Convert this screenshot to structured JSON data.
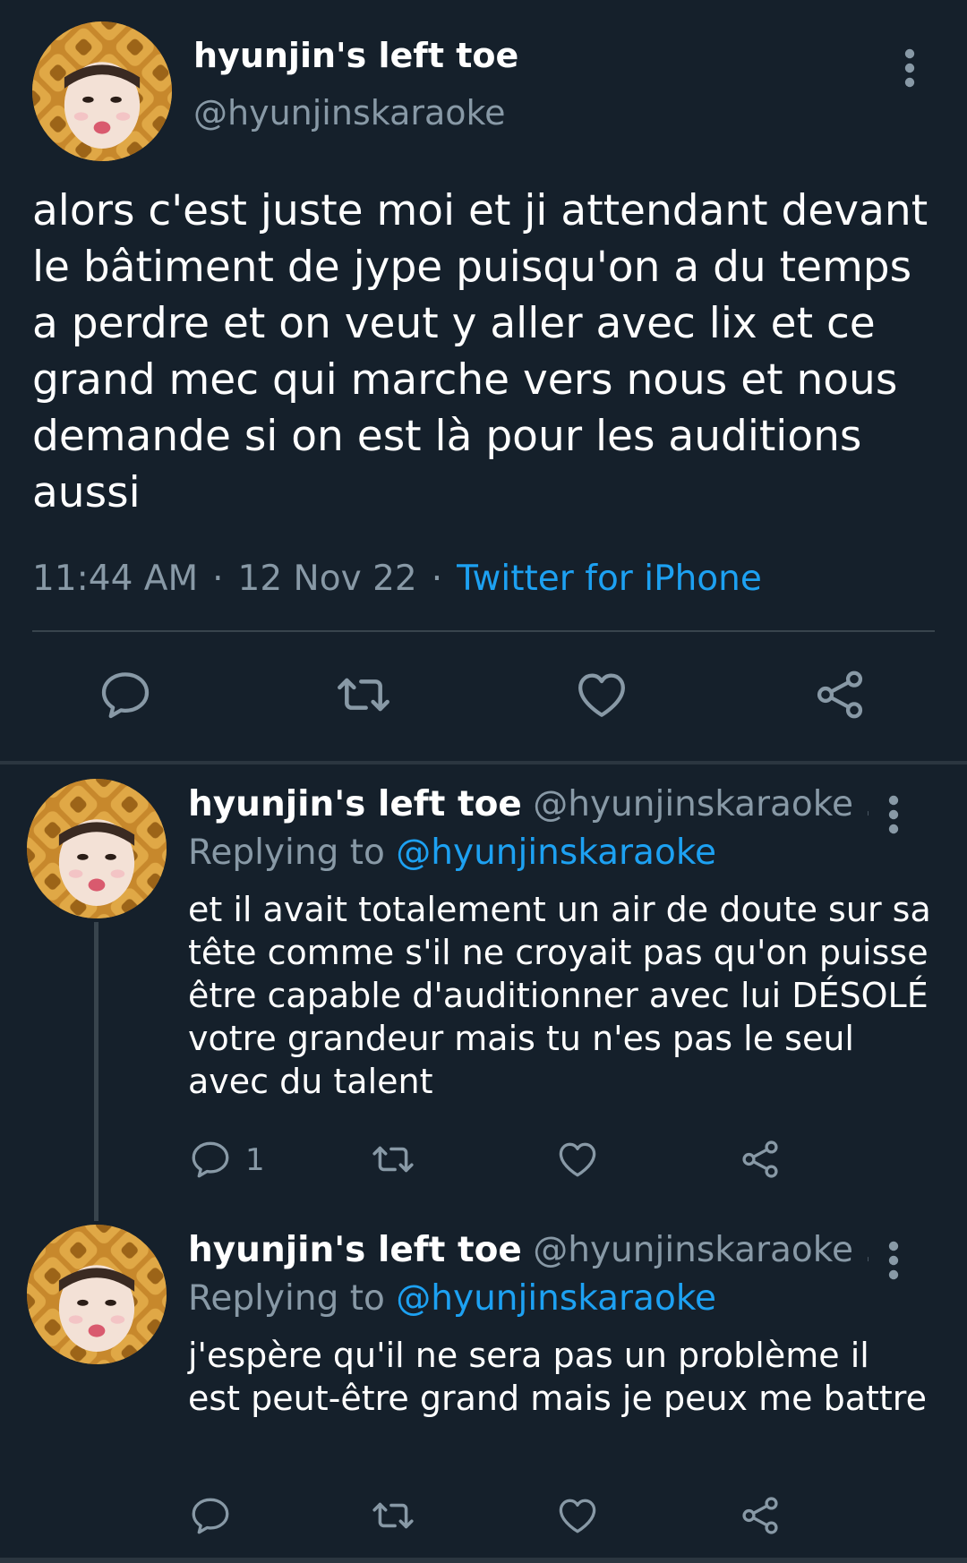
{
  "theme": {
    "background": "#15202b",
    "text": "#ffffff",
    "muted": "#8899a6",
    "accent": "#1da1f2",
    "divider": "#38444d"
  },
  "main_tweet": {
    "display_name": "hyunjin's left toe",
    "handle": "@hyunjinskaraoke",
    "avatar_icon": "avatar-pineapple-hood",
    "more_icon": "more-vertical-icon",
    "text": "alors c'est juste moi et ji attendant devant le bâtiment de jype puisqu'on a du temps a perdre et on veut y aller avec lix et ce grand mec qui marche vers nous et nous demande si on est là pour les auditions aussi",
    "time": "11:44 AM",
    "date": "12 Nov 22",
    "separator": "·",
    "source": "Twitter for iPhone",
    "actions": [
      "reply-icon",
      "retweet-icon",
      "like-icon",
      "share-icon"
    ]
  },
  "replies": [
    {
      "display_name": "hyunjin's left toe",
      "handle": "@hyunjinskaraoke ...",
      "replying_prefix": "Replying to ",
      "replying_to": "@hyunjinskaraoke",
      "text": "et il avait totalement un air de doute sur sa tête comme s'il ne croyait pas qu'on puisse être capable d'auditionner avec lui DÉSOLÉ votre grandeur mais tu n'es pas le seul avec du talent",
      "reply_count": "1"
    },
    {
      "display_name": "hyunjin's left toe",
      "handle": "@hyunjinskaraoke ...",
      "replying_prefix": "Replying to ",
      "replying_to": "@hyunjinskaraoke",
      "text": "j'espère qu'il ne sera pas un problème il est peut-être grand mais je peux me battre",
      "reply_count": ""
    }
  ]
}
